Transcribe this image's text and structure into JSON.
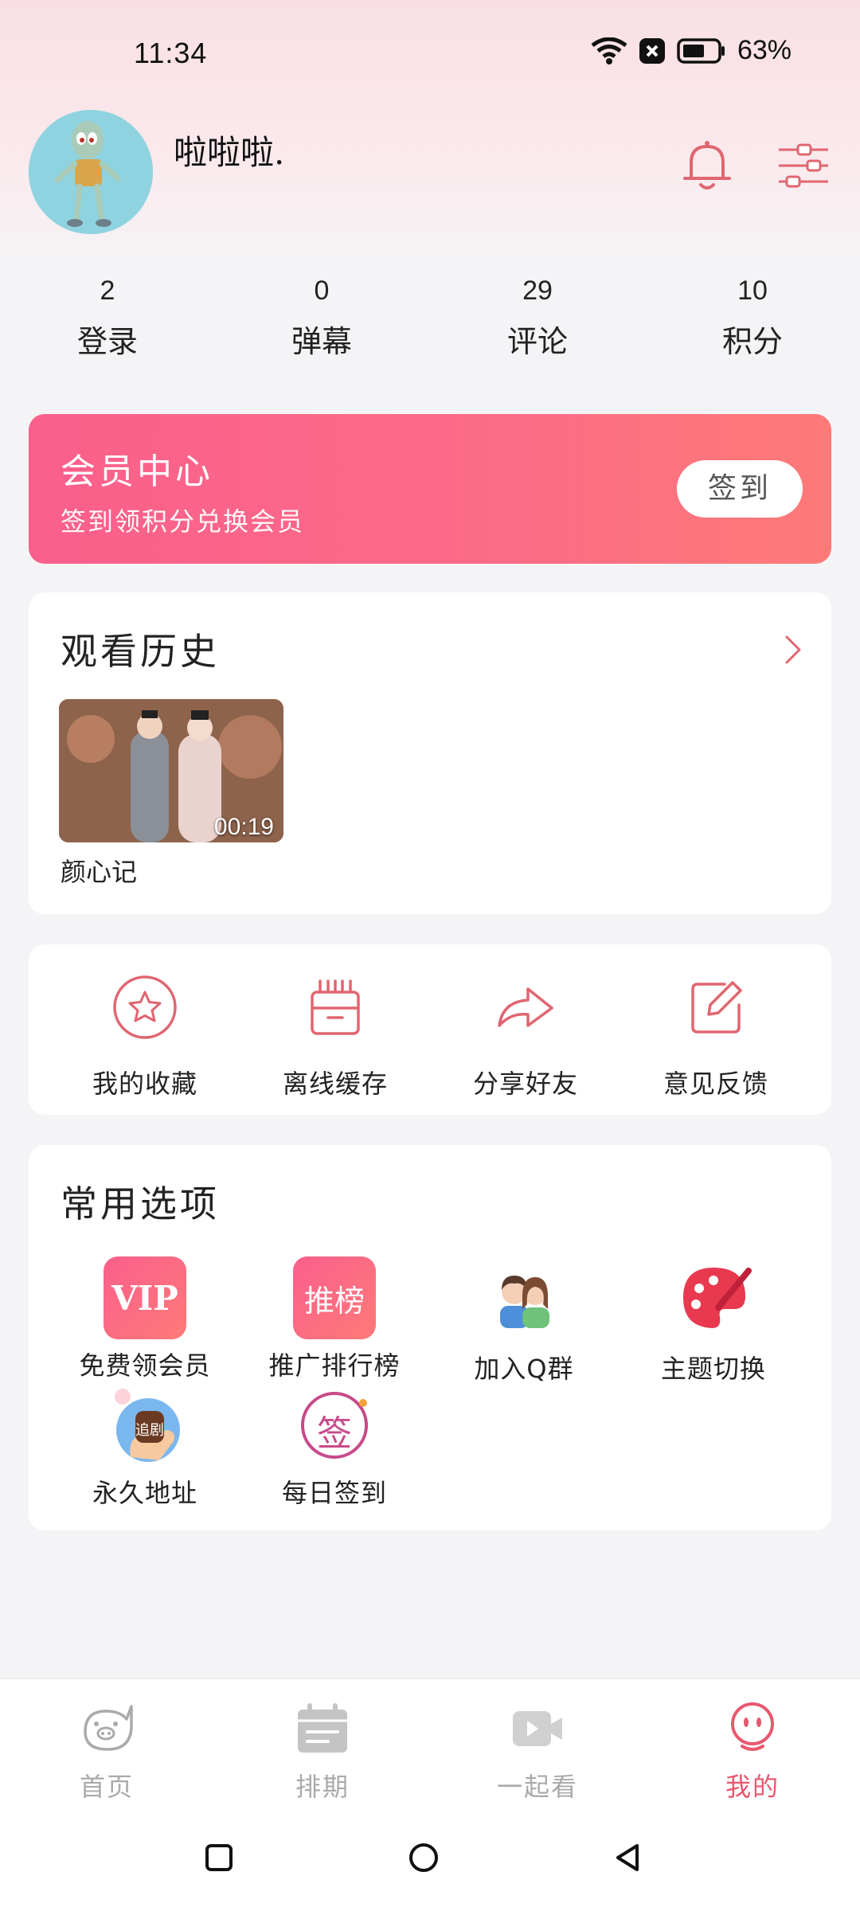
{
  "status_bar": {
    "time": "11:34",
    "battery": "63%"
  },
  "profile": {
    "username": "啦啦啦.",
    "icons": {
      "avatar": "squidward-avatar",
      "notification": "bell-icon",
      "settings": "sliders-icon"
    }
  },
  "stats": [
    {
      "value": "2",
      "label": "登录"
    },
    {
      "value": "0",
      "label": "弹幕"
    },
    {
      "value": "29",
      "label": "评论"
    },
    {
      "value": "10",
      "label": "积分"
    }
  ],
  "vip": {
    "title": "会员中心",
    "subtitle": "签到领积分兑换会员",
    "button": "签到"
  },
  "history": {
    "title": "观看历史",
    "items": [
      {
        "title": "颜心记",
        "time": "00:19"
      }
    ]
  },
  "quick_actions": [
    {
      "label": "我的收藏",
      "icon": "star-circle-icon"
    },
    {
      "label": "离线缓存",
      "icon": "cache-box-icon"
    },
    {
      "label": "分享好友",
      "icon": "share-arrow-icon"
    },
    {
      "label": "意见反馈",
      "icon": "edit-feedback-icon"
    }
  ],
  "common": {
    "title": "常用选项",
    "items": [
      {
        "label": "免费领会员",
        "icon": "vip-icon",
        "tile_text": "VIP"
      },
      {
        "label": "推广排行榜",
        "icon": "ranking-icon",
        "tile_text": "推榜"
      },
      {
        "label": "加入Q群",
        "icon": "group-people-icon"
      },
      {
        "label": "主题切换",
        "icon": "palette-icon"
      },
      {
        "label": "永久地址",
        "icon": "address-hand-icon",
        "tile_text": "追剧"
      },
      {
        "label": "每日签到",
        "icon": "daily-sign-icon",
        "tile_text": "签"
      }
    ]
  },
  "bottom_nav": [
    {
      "label": "首页",
      "icon": "home-pig-icon",
      "active": false
    },
    {
      "label": "排期",
      "icon": "calendar-icon",
      "active": false
    },
    {
      "label": "一起看",
      "icon": "watch-together-icon",
      "active": false
    },
    {
      "label": "我的",
      "icon": "profile-face-icon",
      "active": true
    }
  ],
  "colors": {
    "accent": "#e8576e",
    "vip_gradient_start": "#fb5f8c",
    "vip_gradient_end": "#fd7a78",
    "icon_stroke": "#e06670"
  }
}
